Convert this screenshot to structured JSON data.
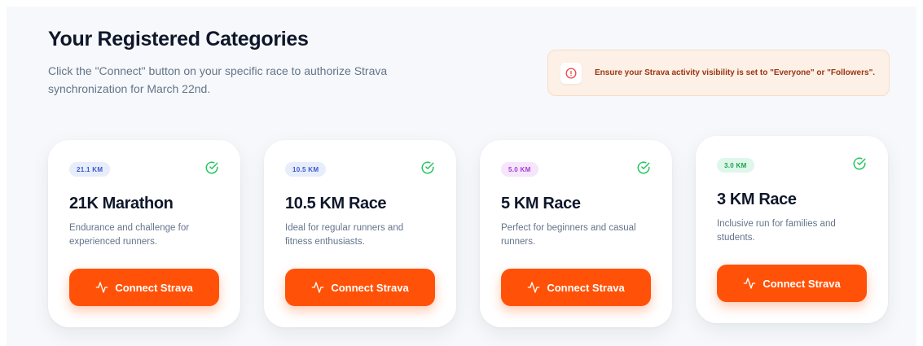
{
  "header": {
    "title": "Your Registered Categories",
    "subtitle": "Click the \"Connect\" button on your specific race to authorize Strava synchronization for March 22nd."
  },
  "notice": {
    "text": "Ensure your Strava activity visibility is set to \"Everyone\" or \"Followers\".",
    "icon": "info-circle-icon",
    "color": "#ef4444"
  },
  "colors": {
    "accent": "#ff5208",
    "check": "#22c55e"
  },
  "categories": [
    {
      "badge": "21.1 KM",
      "badge_bg": "#e8edfb",
      "badge_color": "#3b5bcc",
      "title": "21K Marathon",
      "description": "Endurance and challenge for experienced runners.",
      "button": "Connect Strava"
    },
    {
      "badge": "10.5 KM",
      "badge_bg": "#e8edfb",
      "badge_color": "#3b5bcc",
      "title": "10.5 KM Race",
      "description": "Ideal for regular runners and fitness enthusiasts.",
      "button": "Connect Strava"
    },
    {
      "badge": "5.0 KM",
      "badge_bg": "#f6e6fb",
      "badge_color": "#a43bd6",
      "title": "5 KM Race",
      "description": "Perfect for beginners and casual runners.",
      "button": "Connect Strava"
    },
    {
      "badge": "3.0 KM",
      "badge_bg": "#def7ea",
      "badge_color": "#16a34a",
      "title": "3 KM Race",
      "description": "Inclusive run for families and students.",
      "button": "Connect Strava"
    }
  ]
}
